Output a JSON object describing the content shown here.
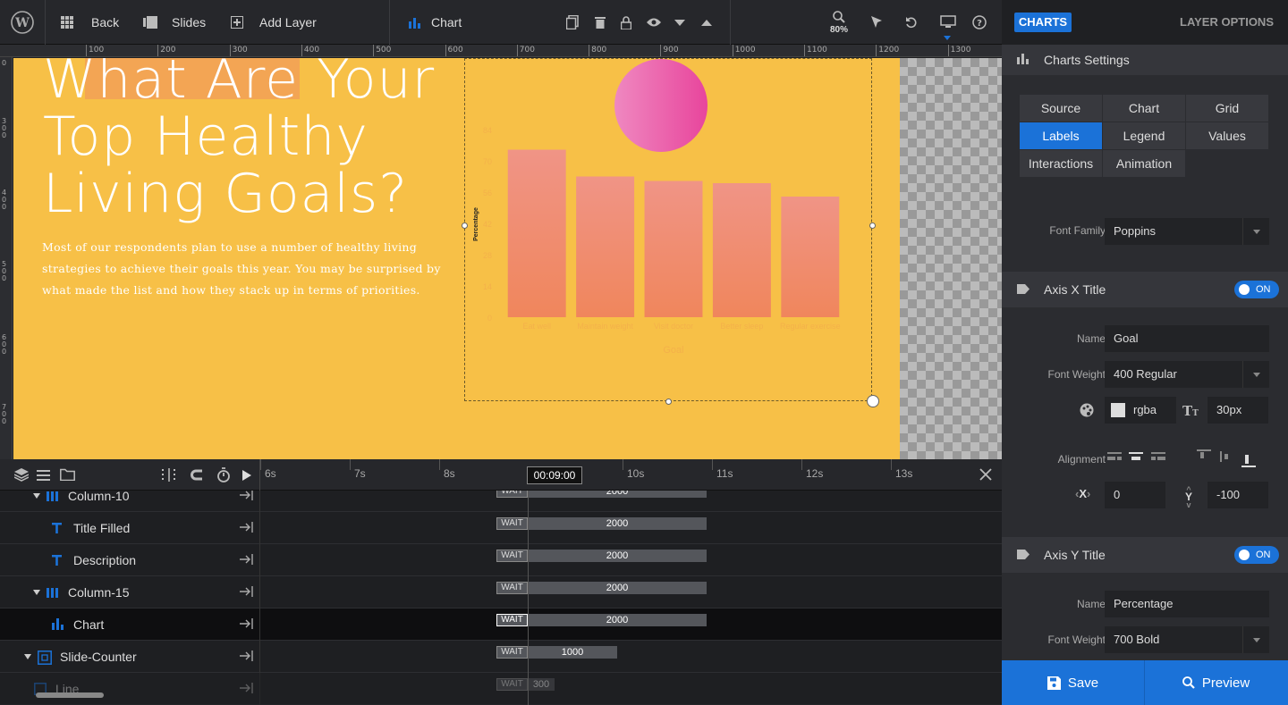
{
  "toolbar": {
    "back": "Back",
    "slides": "Slides",
    "add_layer": "Add Layer",
    "current_layer": "Chart",
    "zoom": "80%"
  },
  "ruler": {
    "h": [
      "100",
      "200",
      "300",
      "400",
      "500",
      "600",
      "700",
      "800",
      "900",
      "1000",
      "1100",
      "1200",
      "1300"
    ],
    "v": [
      "3\n0\n0",
      "4\n0\n0",
      "5\n0\n0",
      "6\n0\n0",
      "7\n0\n0"
    ]
  },
  "slide": {
    "heading_lines": [
      "What Are Your",
      "Top Healthy",
      "Living Goals?"
    ],
    "description": "Most of our respondents plan to use a number of healthy living strategies to achieve their goals this year. You may be surprised by what made the list and how they stack up in terms of priorities."
  },
  "chart_data": {
    "type": "bar",
    "categories": [
      "Eat well",
      "Maintain weight",
      "Visit doctor",
      "Better sleep",
      "Regular exercise"
    ],
    "values": [
      75,
      63,
      61,
      60,
      54
    ],
    "xlabel": "Goal",
    "ylabel": "Percentage",
    "yticks": [
      "0",
      "14",
      "28",
      "42",
      "56",
      "70",
      "84"
    ],
    "ylim": [
      0,
      84
    ],
    "bar_color": "#ef8f6e"
  },
  "timeline": {
    "time": "00:09:00",
    "ticks": [
      "6s",
      "7s",
      "8s",
      "10s",
      "11s",
      "12s",
      "13s"
    ]
  },
  "layers": [
    {
      "name": "Column-10",
      "type": "column",
      "indent": 1,
      "wait": "WAIT",
      "dur": "2000"
    },
    {
      "name": "Title Filled",
      "type": "text",
      "indent": 2,
      "wait": "WAIT",
      "dur": "2000"
    },
    {
      "name": "Description",
      "type": "text",
      "indent": 2,
      "wait": "WAIT",
      "dur": "2000"
    },
    {
      "name": "Column-15",
      "type": "column",
      "indent": 1,
      "wait": "WAIT",
      "dur": "2000"
    },
    {
      "name": "Chart",
      "type": "chart",
      "indent": 2,
      "wait": "WAIT",
      "dur": "2000"
    },
    {
      "name": "Slide-Counter",
      "type": "counter",
      "indent": 0,
      "wait": "WAIT",
      "dur": "1000"
    },
    {
      "name": "Line",
      "type": "line",
      "indent": 1,
      "wait": "WAIT",
      "dur": "300"
    }
  ],
  "panel": {
    "tab_charts": "CHARTS",
    "tab_layer_options": "LAYER OPTIONS",
    "charts_settings": "Charts Settings",
    "subtabs": [
      "Source",
      "Chart",
      "Grid",
      "Labels",
      "Legend",
      "Values",
      "Interactions",
      "Animation"
    ],
    "font_family_label": "Font Family",
    "font_family": "Poppins",
    "axis_x": {
      "title": "Axis X Title",
      "toggle": "ON",
      "name_label": "Name",
      "name": "Goal",
      "weight_label": "Font Weight",
      "weight": "400 Regular",
      "color": "rgba",
      "size": "30px",
      "align_label": "Alignment",
      "x": "0",
      "y": "-100"
    },
    "axis_y": {
      "title": "Axis Y Title",
      "toggle": "ON",
      "name_label": "Name",
      "name": "Percentage",
      "weight_label": "Font Weight",
      "weight": "700 Bold"
    },
    "save": "Save",
    "preview": "Preview"
  }
}
